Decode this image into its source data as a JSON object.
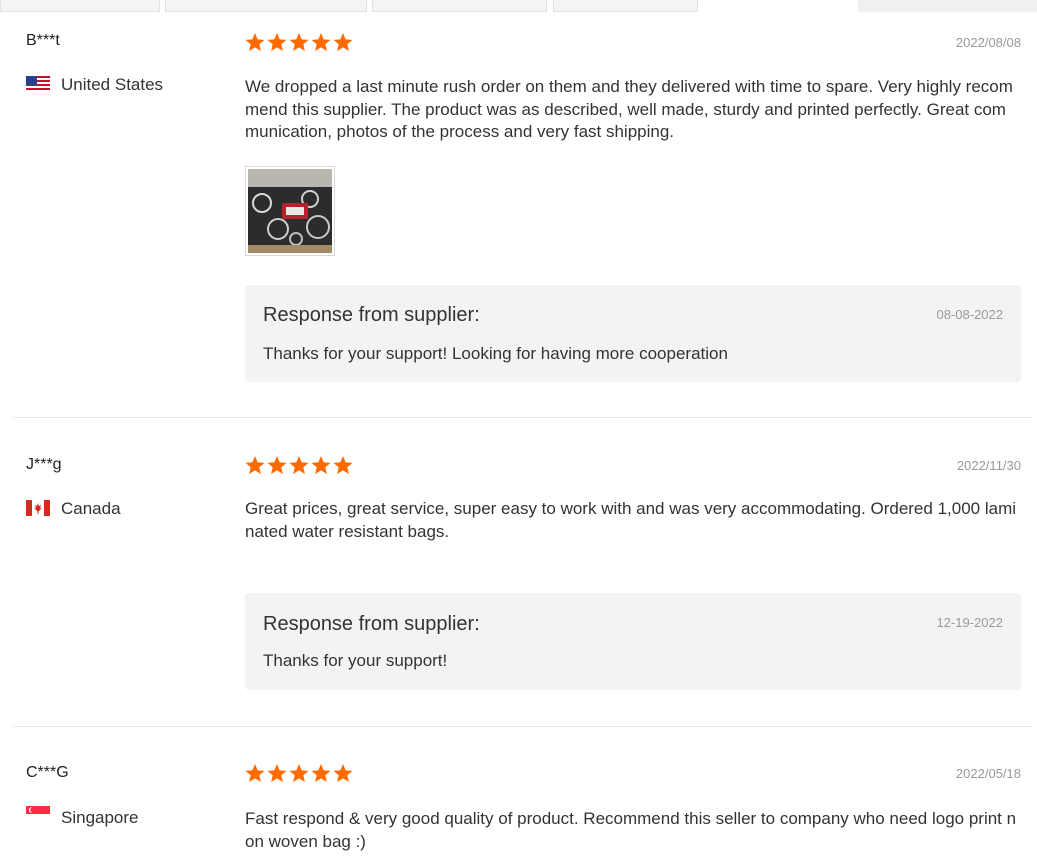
{
  "tabs": [
    "",
    "",
    "",
    "",
    "",
    ""
  ],
  "reviews": [
    {
      "user": "B***t",
      "country": "United States",
      "flag_icon": "us-flag-icon",
      "rating": 5,
      "date": "2022/08/08",
      "text": "We dropped a last minute rush order on them and they delivered with time to spare. Very highly recommend this supplier. The product was as described, well made, sturdy and printed perfectly. Great communication, photos of the process and very fast shipping.",
      "has_photo": true,
      "response": {
        "title": "Response from supplier:",
        "date": "08-08-2022",
        "text": "Thanks for your support! Looking for having more cooperation"
      }
    },
    {
      "user": "J***g",
      "country": "Canada",
      "flag_icon": "canada-flag-icon",
      "rating": 5,
      "date": "2022/11/30",
      "text": "Great prices, great service, super easy to work with and was very accommodating. Ordered 1,000 laminated water resistant bags.",
      "has_photo": false,
      "response": {
        "title": "Response from supplier:",
        "date": "12-19-2022",
        "text": "Thanks for your support!"
      }
    },
    {
      "user": "C***G",
      "country": "Singapore",
      "flag_icon": "singapore-flag-icon",
      "rating": 5,
      "date": "2022/05/18",
      "text": "Fast respond & very good quality of product. Recommend this seller to company who need logo print non woven bag :)",
      "has_photo": false
    }
  ],
  "colors": {
    "star": "#ff6a00",
    "response_bg": "#f3f3f3",
    "date_text": "#999999"
  }
}
